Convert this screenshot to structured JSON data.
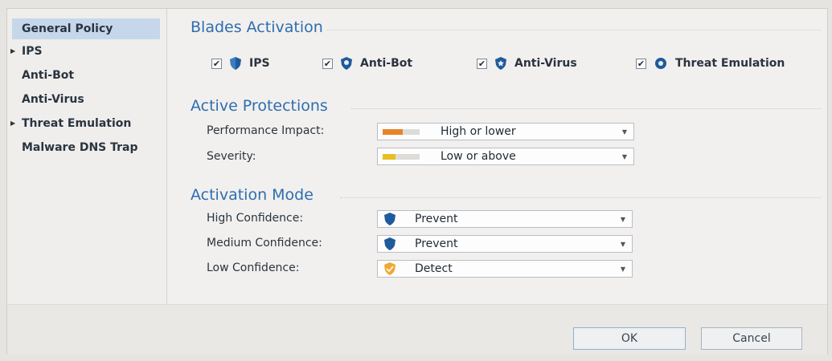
{
  "sidebar": {
    "items": [
      {
        "label": "General Policy",
        "expandable": false,
        "active": true
      },
      {
        "label": "IPS",
        "expandable": true,
        "active": false
      },
      {
        "label": "Anti-Bot",
        "expandable": false,
        "active": false
      },
      {
        "label": "Anti-Virus",
        "expandable": false,
        "active": false
      },
      {
        "label": "Threat Emulation",
        "expandable": true,
        "active": false
      },
      {
        "label": "Malware DNS Trap",
        "expandable": false,
        "active": false
      }
    ]
  },
  "blades": {
    "title": "Blades Activation",
    "items": [
      {
        "label": "IPS",
        "checked": true,
        "icon": "ips-shield-icon"
      },
      {
        "label": "Anti-Bot",
        "checked": true,
        "icon": "anti-bot-shield-icon"
      },
      {
        "label": "Anti-Virus",
        "checked": true,
        "icon": "anti-virus-shield-icon"
      },
      {
        "label": "Threat Emulation",
        "checked": true,
        "icon": "threat-emulation-gear-icon"
      }
    ]
  },
  "active_protections": {
    "title": "Active Protections",
    "performance_impact": {
      "label": "Performance Impact:",
      "value": "High or lower",
      "level": 0.55,
      "color": "#e8842a"
    },
    "severity": {
      "label": "Severity:",
      "value": "Low or above",
      "level": 0.35,
      "color": "#e6c020"
    }
  },
  "activation_mode": {
    "title": "Activation Mode",
    "high": {
      "label": "High Confidence:",
      "value": "Prevent",
      "icon": "prevent-shield-icon"
    },
    "medium": {
      "label": "Medium Confidence:",
      "value": "Prevent",
      "icon": "prevent-shield-icon"
    },
    "low": {
      "label": "Low Confidence:",
      "value": "Detect",
      "icon": "detect-shield-icon"
    }
  },
  "footer": {
    "ok_label": "OK",
    "cancel_label": "Cancel"
  },
  "colors": {
    "accent": "#2f6db0",
    "selected": "#c6d7ea",
    "shield_blue": "#1f5a9c",
    "detect_orange": "#f0a830"
  }
}
